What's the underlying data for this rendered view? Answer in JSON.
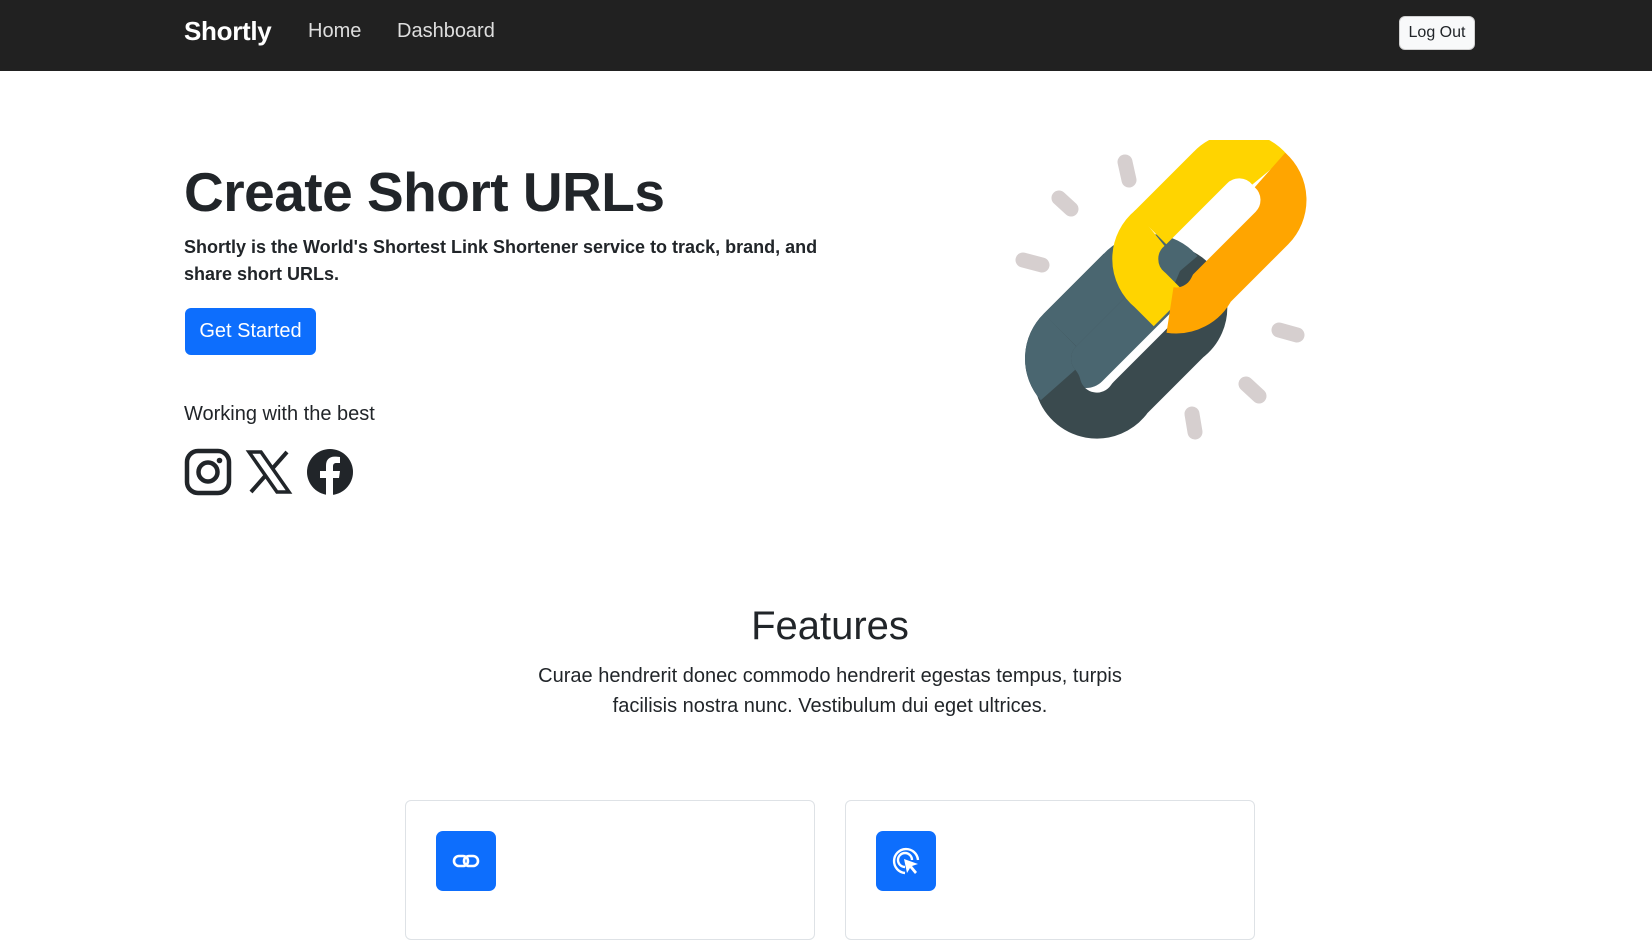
{
  "navbar": {
    "brand": "Shortly",
    "links": [
      "Home",
      "Dashboard"
    ],
    "logout_label": "Log Out"
  },
  "hero": {
    "title": "Create Short URLs",
    "subtitle": "Shortly is the World's Shortest Link Shortener service to track, brand, and share short URLs.",
    "cta_label": "Get Started",
    "partners_label": "Working with the best",
    "partner_icons": [
      "instagram-icon",
      "x-icon",
      "facebook-icon"
    ],
    "illustration": "chain-link-icon"
  },
  "features": {
    "title": "Features",
    "description": "Curae hendrerit donec commodo hendrerit egestas tempus, turpis facilisis nostra nunc. Vestibulum dui eget ultrices.",
    "cards": [
      {
        "icon": "link-icon"
      },
      {
        "icon": "click-cursor-icon"
      }
    ]
  },
  "colors": {
    "navbar_bg": "#212121",
    "primary": "#0d6efd",
    "chain_dark": "#4a6670",
    "chain_gold": "#ffd400",
    "chain_orange": "#ffa500",
    "spark": "#d6cfcf"
  }
}
